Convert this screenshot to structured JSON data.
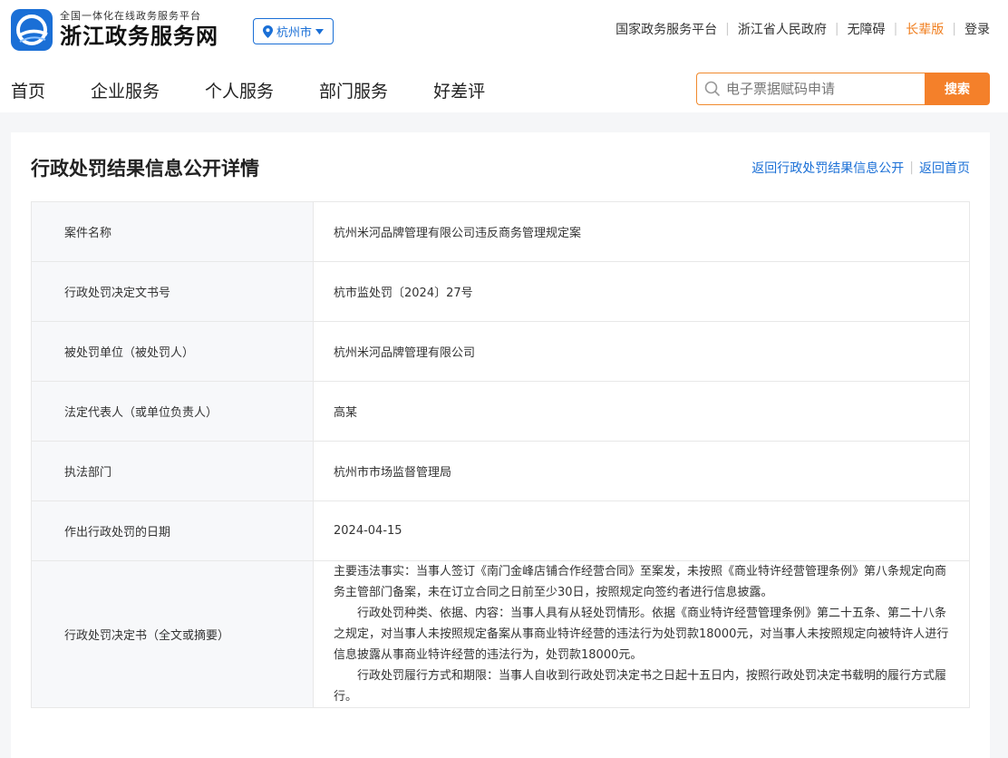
{
  "header": {
    "logo_sub": "全国一体化在线政务服务平台",
    "logo_main": "浙江政务服务网",
    "city": "杭州市",
    "top_links": [
      "国家政务服务平台",
      "浙江省人民政府",
      "无障碍",
      "长辈版",
      "登录"
    ],
    "nav": [
      "首页",
      "企业服务",
      "个人服务",
      "部门服务",
      "好差评"
    ],
    "search_placeholder": "电子票据赋码申请",
    "search_button": "搜索"
  },
  "page": {
    "title": "行政处罚结果信息公开详情",
    "back_link_list": "返回行政处罚结果信息公开",
    "back_link_home": "返回首页"
  },
  "rows": [
    {
      "label": "案件名称",
      "value": "杭州米河品牌管理有限公司违反商务管理规定案"
    },
    {
      "label": "行政处罚决定文书号",
      "value": "杭市监处罚〔2024〕27号"
    },
    {
      "label": "被处罚单位（被处罚人）",
      "value": "杭州米河品牌管理有限公司"
    },
    {
      "label": "法定代表人（或单位负责人）",
      "value": "高某"
    },
    {
      "label": "执法部门",
      "value": "杭州市市场监督管理局"
    },
    {
      "label": "作出行政处罚的日期",
      "value": "2024-04-15"
    }
  ],
  "decision": {
    "label": "行政处罚决定书（全文或摘要）",
    "paragraphs": [
      "主要违法事实：当事人签订《南门金峰店铺合作经营合同》至案发，未按照《商业特许经营管理条例》第八条规定向商务主管部门备案，未在订立合同之日前至少30日，按照规定向签约者进行信息披露。",
      "行政处罚种类、依据、内容：当事人具有从轻处罚情形。依据《商业特许经营管理条例》第二十五条、第二十八条之规定，对当事人未按照规定备案从事商业特许经营的违法行为处罚款18000元，对当事人未按照规定向被特许人进行信息披露从事商业特许经营的违法行为，处罚款18000元。",
      "行政处罚履行方式和期限：当事人自收到行政处罚决定书之日起十五日内，按照行政处罚决定书载明的履行方式履行。"
    ]
  },
  "colors": {
    "brand_blue": "#1a6fd6",
    "accent_orange": "#f4802a"
  }
}
